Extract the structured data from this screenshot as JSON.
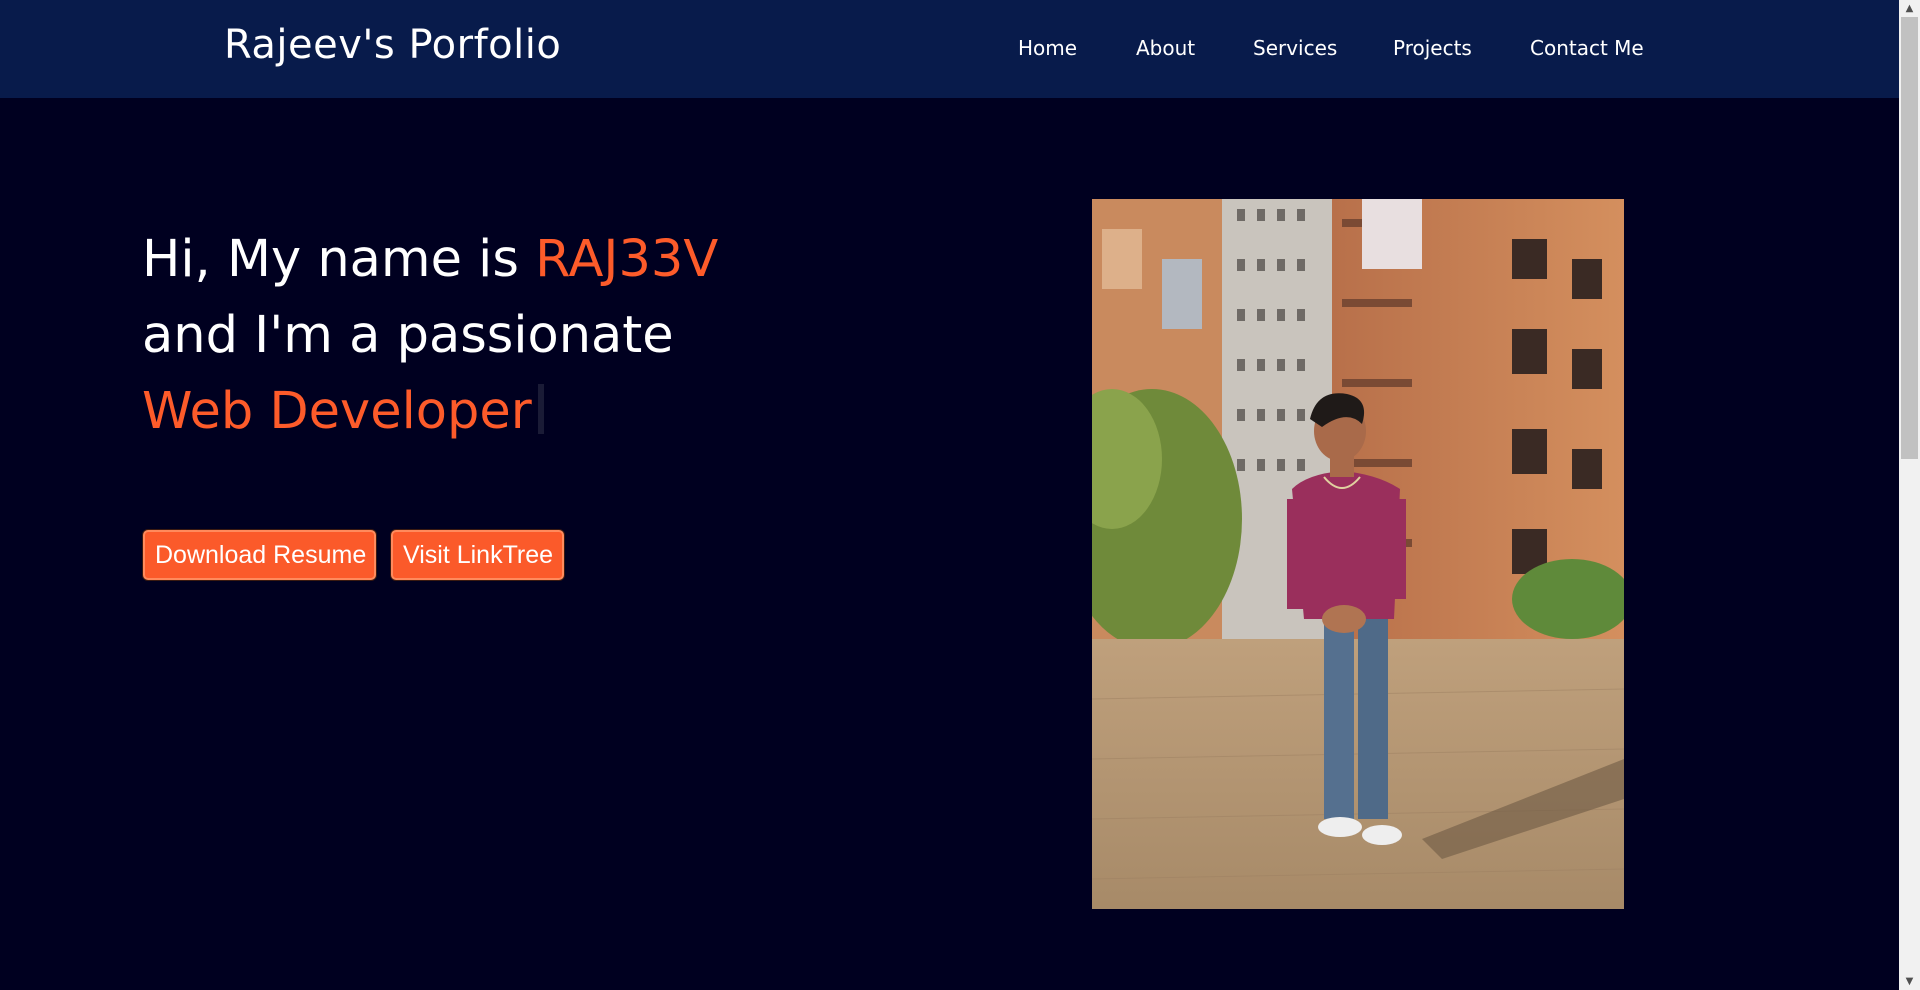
{
  "nav": {
    "brand": "Rajeev's Porfolio",
    "links": [
      "Home",
      "About",
      "Services",
      "Projects",
      "Contact Me"
    ]
  },
  "hero": {
    "line1_prefix": "Hi, My name is ",
    "line1_name": "RAJ33V",
    "line2": "and I'm a passionate",
    "line3_role": "Web Developer"
  },
  "buttons": {
    "resume": "Download Resume",
    "linktree": "Visit LinkTree"
  },
  "colors": {
    "background": "#000020",
    "navbar": "#081b4b",
    "accent": "#fd5b2a",
    "text": "#ffffff"
  },
  "icons": {
    "scroll_up": "chevron-up-icon",
    "scroll_down": "chevron-down-icon"
  }
}
